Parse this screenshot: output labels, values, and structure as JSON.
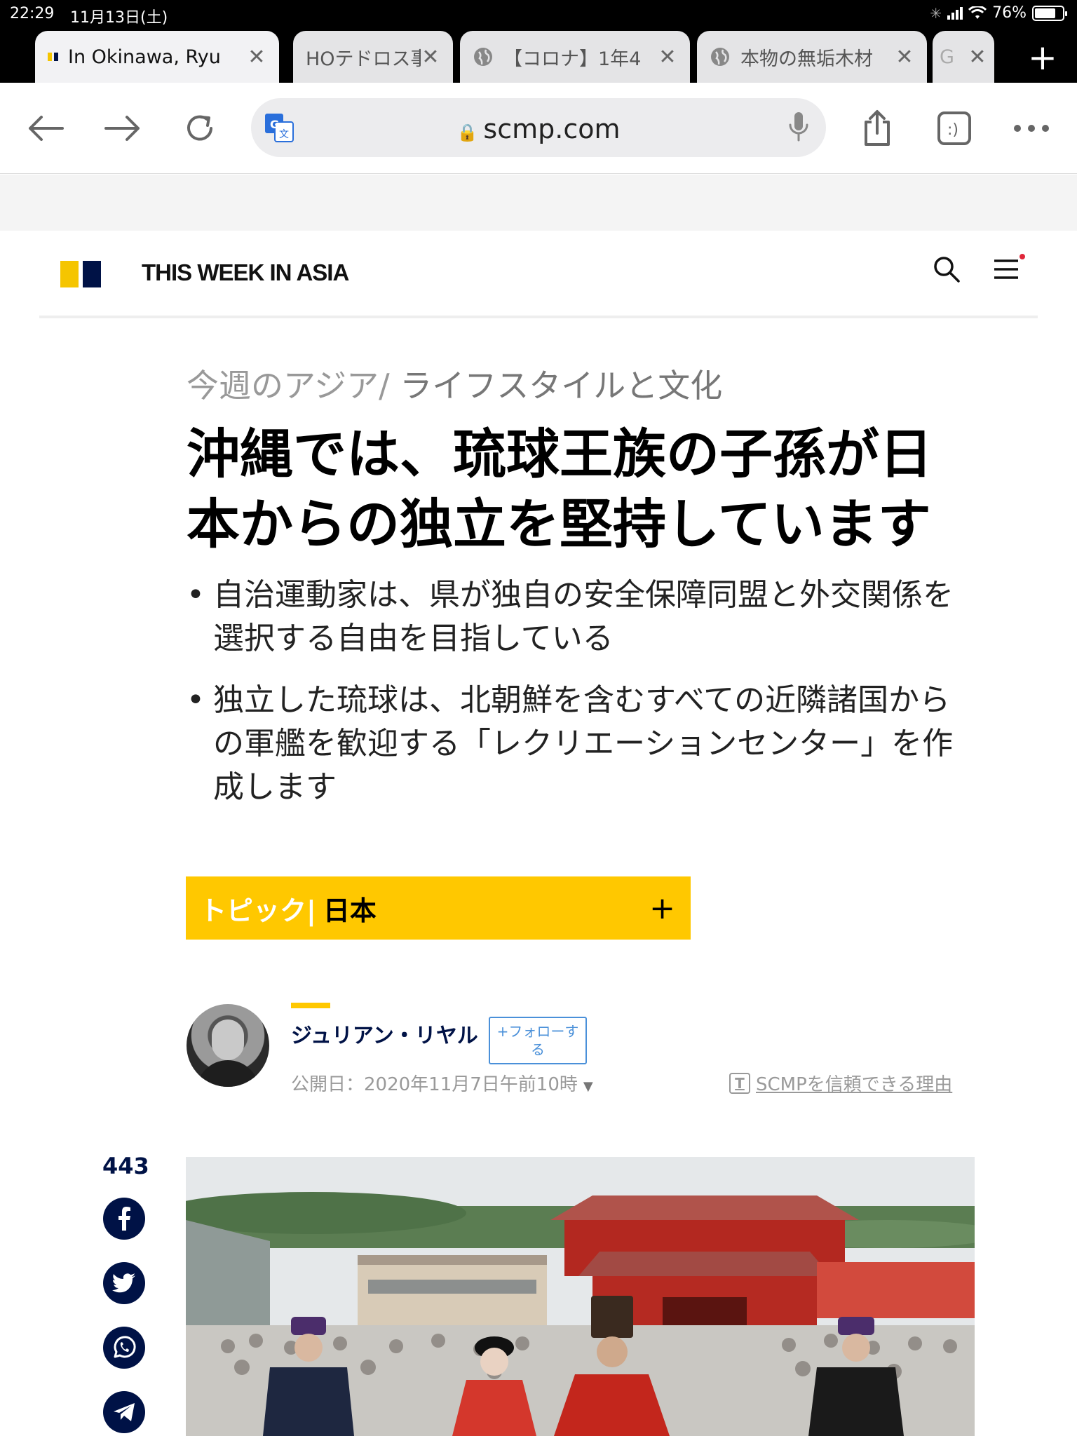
{
  "status_bar": {
    "time": "22:29",
    "date": "11月13日(土)",
    "battery": "76%",
    "battery_level": 0.76
  },
  "tabs": [
    {
      "title": "In Okinawa, Ryu",
      "active": true
    },
    {
      "title": "HOテドロス事",
      "active": false
    },
    {
      "title": "【コロナ】1年4",
      "active": false
    },
    {
      "title": "本物の無垢木材",
      "active": false
    },
    {
      "title": "G",
      "active": false
    }
  ],
  "toolbar": {
    "url": "scmp.com"
  },
  "site": {
    "name": "THIS WEEK IN ASIA",
    "colors": {
      "brand_yellow": "#ffc800",
      "brand_navy": "#001246"
    }
  },
  "article": {
    "breadcrumb_section": "今週のアジア/",
    "breadcrumb_category": "ライフスタイルと文化",
    "headline": "沖縄では、琉球王族の子孫が日本からの独立を堅持しています",
    "bullets": [
      "自治運動家は、県が独自の安全保障同盟と外交関係を選択する自由を目指している",
      "独立した琉球は、北朝鮮を含むすべての近隣諸国からの軍艦を歓迎する「レクリエーションセンター」を作成します"
    ],
    "topic_label": "トピック|",
    "topic_name": "日本",
    "topic_plus": "+",
    "author_name": "ジュリアン・リヤル",
    "follow_label": "+フォローする",
    "published": "公開日：2020年11月7日午前10時",
    "trust_link": "SCMPを信頼できる理由",
    "share_count": "443"
  }
}
